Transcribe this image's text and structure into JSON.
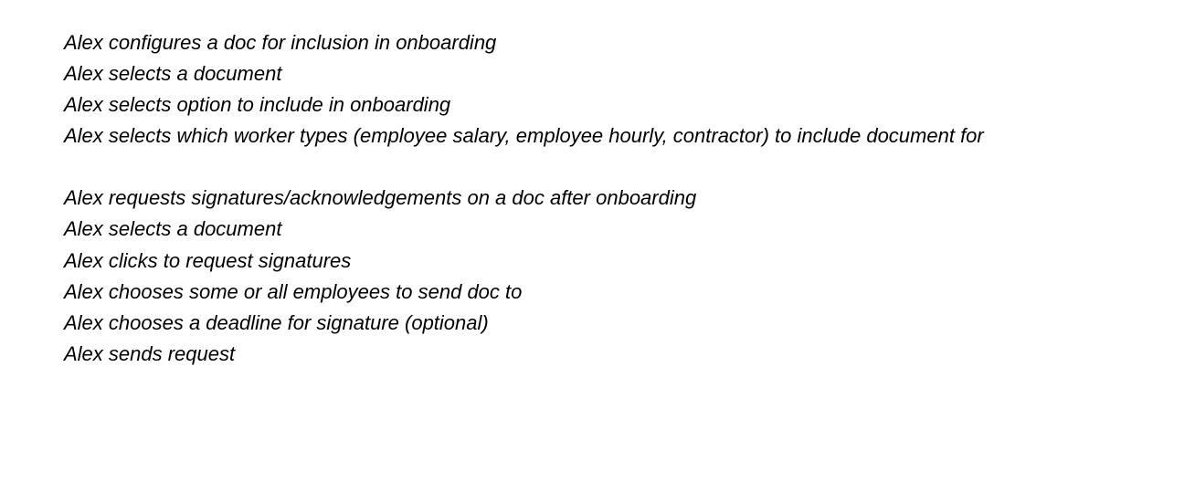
{
  "sections": [
    {
      "lines": [
        "Alex configures a doc for inclusion in onboarding",
        "Alex selects a document",
        "Alex selects option to include in onboarding",
        "Alex selects which worker types (employee salary, employee hourly, contractor) to include document for"
      ]
    },
    {
      "lines": [
        "Alex requests signatures/acknowledgements on a doc after onboarding",
        "Alex selects a document",
        "Alex clicks to request signatures",
        "Alex chooses some or all employees to send doc to",
        "Alex chooses a deadline for signature (optional)",
        "Alex sends request"
      ]
    }
  ]
}
